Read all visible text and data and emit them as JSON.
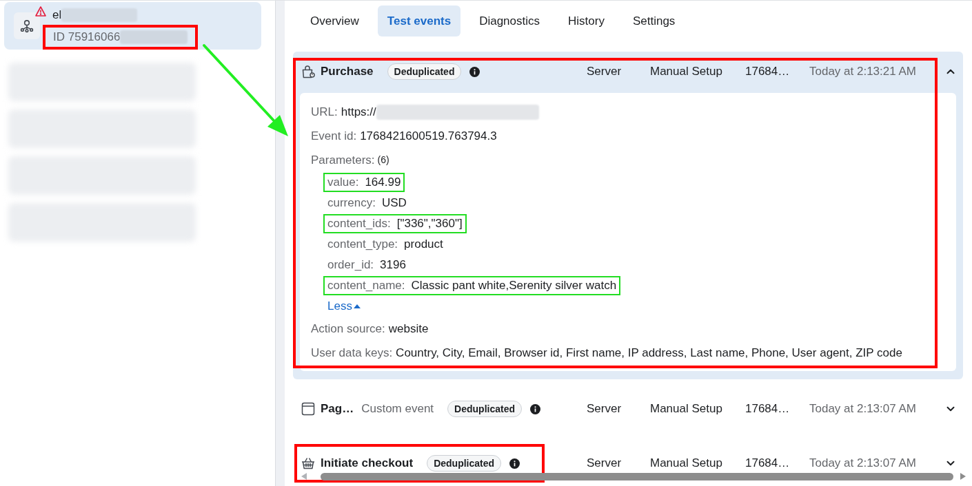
{
  "sidebar": {
    "items": [
      {
        "kind": "account",
        "selected": true,
        "warning": true,
        "name": "el",
        "id": "ID 75916066",
        "id_highlight": true
      },
      {
        "kind": "blurred",
        "selected": false
      },
      {
        "kind": "blurred",
        "selected": false
      },
      {
        "kind": "blurred",
        "selected": false
      },
      {
        "kind": "blurred",
        "selected": false
      }
    ]
  },
  "tabs": [
    {
      "label": "Overview",
      "selected": false
    },
    {
      "label": "Test events",
      "selected": true
    },
    {
      "label": "Diagnostics",
      "selected": false
    },
    {
      "label": "History",
      "selected": false
    },
    {
      "label": "Settings",
      "selected": false
    }
  ],
  "events": [
    {
      "kind": "purchase",
      "name": "Purchase",
      "badge": "Deduplicated",
      "source": "Server",
      "setup": "Manual Setup",
      "id": "17684…",
      "time": "Today at 2:13:21 AM",
      "expanded": true,
      "highlight": true,
      "name_highlight": false,
      "details": {
        "url": {
          "label": "URL:",
          "value": "https://"
        },
        "event_id": {
          "label": "Event id:",
          "value": "1768421600519.763794.3"
        },
        "parameters": {
          "label": "Parameters:",
          "count": "(6)",
          "toggle": "Less",
          "items": [
            {
              "key": "value:",
              "value": "164.99",
              "highlight": true
            },
            {
              "key": "currency:",
              "value": "USD",
              "highlight": false
            },
            {
              "key": "content_ids:",
              "value": "[\"336\",\"360\"]",
              "highlight": true
            },
            {
              "key": "content_type:",
              "value": "product",
              "highlight": false
            },
            {
              "key": "order_id:",
              "value": "3196",
              "highlight": false
            },
            {
              "key": "content_name:",
              "value": "Classic pant white,Serenity silver watch",
              "highlight": true
            }
          ]
        },
        "action_source": {
          "label": "Action source:",
          "value": "website"
        },
        "user_data_keys": {
          "label": "User data keys:",
          "value": "Country, City, Email, Browser id, First name, IP address, Last name, Phone, User agent, ZIP code"
        }
      }
    },
    {
      "kind": "pageview",
      "name": "Pag…",
      "subtitle": "Custom event",
      "badge": "Deduplicated",
      "source": "Server",
      "setup": "Manual Setup",
      "id": "17684…",
      "time": "Today at 2:13:07 AM",
      "expanded": false,
      "highlight": false,
      "name_highlight": false
    },
    {
      "kind": "checkout",
      "name": "Initiate checkout",
      "badge": "Deduplicated",
      "source": "Server",
      "setup": "Manual Setup",
      "id": "17684…",
      "time": "Today at 2:13:07 AM",
      "expanded": false,
      "highlight": false,
      "name_highlight": true
    }
  ]
}
